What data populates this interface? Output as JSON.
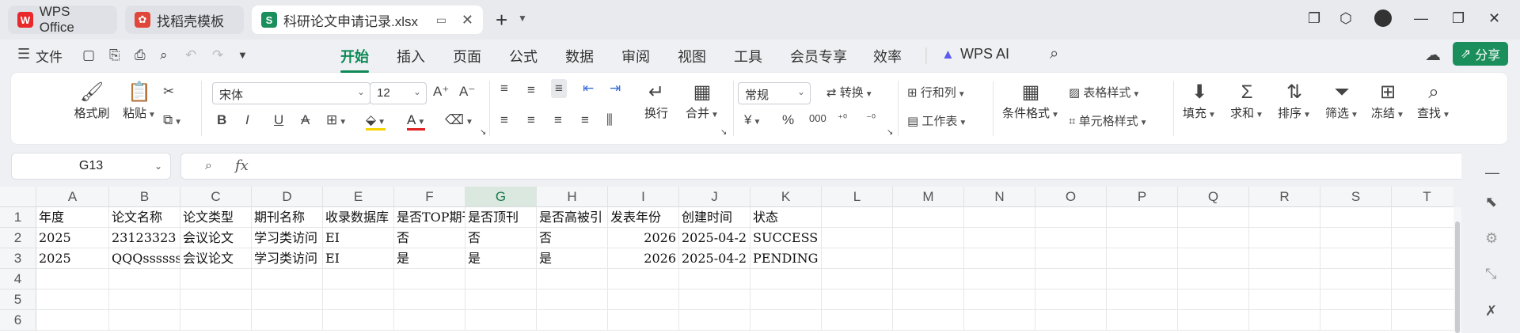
{
  "tabs": [
    {
      "label": "WPS Office",
      "icon": "wps-logo-icon"
    },
    {
      "label": "找稻壳模板",
      "icon": "docer-logo-icon"
    },
    {
      "label": "科研论文申请记录.xlsx",
      "icon": "spreadsheet-s-icon",
      "active": true
    }
  ],
  "menu": {
    "file_label": "文件",
    "items": [
      "开始",
      "插入",
      "页面",
      "公式",
      "数据",
      "审阅",
      "视图",
      "工具",
      "会员专享",
      "效率"
    ],
    "active": "开始",
    "wps_ai": "WPS AI",
    "share": "分享"
  },
  "ribbon": {
    "format_painter": "格式刷",
    "paste": "粘贴",
    "font_name": "宋体",
    "font_size": "12",
    "number_format": "常规",
    "convert": "转换",
    "wrap": "换行",
    "merge": "合并",
    "rows_cols": "行和列",
    "worksheet": "工作表",
    "conditional_format": "条件格式",
    "table_style": "表格样式",
    "cell_style": "单元格样式",
    "fill": "填充",
    "sum": "求和",
    "sort": "排序",
    "filter": "筛选",
    "freeze": "冻结",
    "find": "查找"
  },
  "formula_bar": {
    "name_box": "G13",
    "fx": "fx",
    "content": ""
  },
  "sheet": {
    "selected_column": "G",
    "columns": [
      "A",
      "B",
      "C",
      "D",
      "E",
      "F",
      "G",
      "H",
      "I",
      "J",
      "K",
      "L",
      "M",
      "N",
      "O",
      "P",
      "Q",
      "R",
      "S",
      "T"
    ],
    "row_numbers": [
      "1",
      "2",
      "3",
      "4",
      "5",
      "6"
    ],
    "rows": [
      [
        "年度",
        "论文名称",
        "论文类型",
        "期刊名称",
        "收录数据库",
        "是否TOP期刊",
        "是否顶刊",
        "是否高被引",
        "发表年份",
        "创建时间",
        "状态"
      ],
      [
        "2025",
        "23123323",
        "会议论文",
        "学习类访问",
        "EI",
        "否",
        "否",
        "否",
        "2026",
        "2025-04-2",
        "SUCCESS"
      ],
      [
        "2025",
        "QQQssssss",
        "会议论文",
        "学习类访问",
        "EI",
        "是",
        "是",
        "是",
        "2026",
        "2025-04-2",
        "PENDING"
      ]
    ]
  },
  "colors": {
    "accent": "#0d8a57",
    "share_bg": "#1a8f5c",
    "selected_col_bg": "#dbe8df"
  }
}
